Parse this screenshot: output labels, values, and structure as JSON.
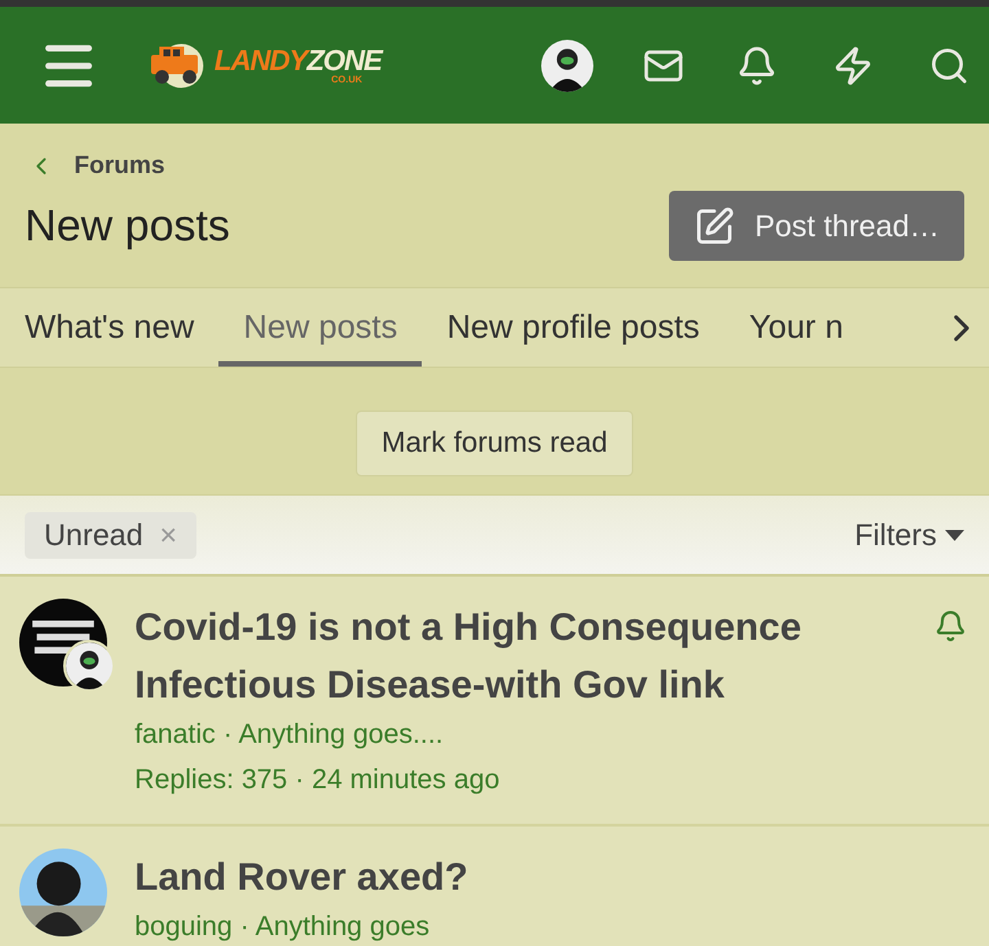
{
  "header": {
    "logo": {
      "word_1": "LANDY",
      "word_2": "ZONE",
      "domain": "CO.UK"
    }
  },
  "breadcrumb": {
    "label": "Forums"
  },
  "page_title": "New posts",
  "post_thread_button": "Post thread…",
  "tabs": [
    {
      "label": "What's new",
      "selected": false
    },
    {
      "label": "New posts",
      "selected": true
    },
    {
      "label": "New profile posts",
      "selected": false
    },
    {
      "label": "Your n",
      "selected": false
    }
  ],
  "mark_read_button": "Mark forums read",
  "filter_bar": {
    "active_filter": {
      "label": "Unread",
      "remove": "×"
    },
    "filters_button": "Filters"
  },
  "threads": [
    {
      "title": "Covid-19 is not a High Consequence Infectious Disease-with Gov link",
      "author_forum": "fanatic · Anything goes....",
      "stats": "Replies: 375 · 24 minutes ago",
      "watched": true,
      "has_second_avatar": true
    },
    {
      "title": "Land Rover axed?",
      "author_forum": "boguing · Anything goes",
      "watched": false,
      "has_second_avatar": false
    }
  ]
}
